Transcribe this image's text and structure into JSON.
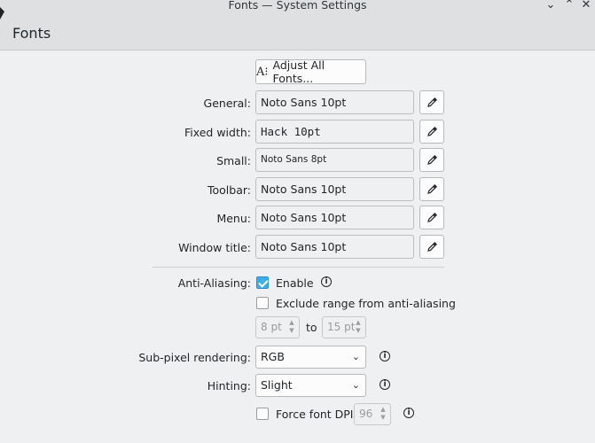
{
  "window": {
    "title": "Fonts — System Settings",
    "page_title": "Fonts",
    "controls": [
      "chevron-down-icon",
      "chevron-up-icon",
      "close-icon"
    ]
  },
  "adjust_all_fonts": {
    "label": "Adjust All Fonts...",
    "icon": "font-adjust-icon"
  },
  "fonts": [
    {
      "label": "General:",
      "value": "Noto Sans 10pt"
    },
    {
      "label": "Fixed width:",
      "value": "Hack 10pt"
    },
    {
      "label": "Small:",
      "value": "Noto Sans 8pt"
    },
    {
      "label": "Toolbar:",
      "value": "Noto Sans 10pt"
    },
    {
      "label": "Menu:",
      "value": "Noto Sans 10pt"
    },
    {
      "label": "Window title:",
      "value": "Noto Sans 10pt"
    }
  ],
  "anti_aliasing": {
    "label": "Anti-Aliasing:",
    "enable_label": "Enable",
    "enable_checked": true,
    "exclude_label": "Exclude range from anti-aliasing",
    "exclude_checked": false,
    "range_from": "8 pt",
    "range_to_label": "to",
    "range_to": "15 pt"
  },
  "subpixel": {
    "label": "Sub-pixel rendering:",
    "value": "RGB"
  },
  "hinting": {
    "label": "Hinting:",
    "value": "Slight"
  },
  "force_dpi": {
    "label": "Force font DPI:",
    "checked": false,
    "value": "96"
  },
  "colors": {
    "accent": "#3daee9",
    "background": "#eff0f1",
    "header": "#dfe0e1"
  }
}
